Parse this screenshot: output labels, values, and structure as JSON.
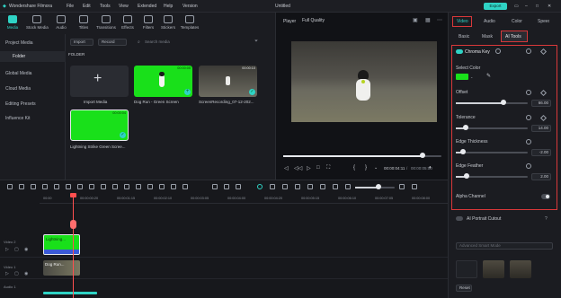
{
  "app": {
    "name": "Wondershare Filmora",
    "doc_title": "Untitled",
    "export_label": "Export"
  },
  "menu": [
    "File",
    "Edit",
    "Tools",
    "View",
    "Extended",
    "Help",
    "Version"
  ],
  "toolbar": [
    "Media",
    "Stock Media",
    "Audio",
    "Titles",
    "Transitions",
    "Effects",
    "Filters",
    "Stickers",
    "Templates"
  ],
  "sidebar": {
    "items": [
      {
        "label": "Project Media"
      },
      {
        "label": "Folder"
      },
      {
        "label": "Global Media"
      },
      {
        "label": "Cloud Media"
      },
      {
        "label": "Editing Presets"
      },
      {
        "label": "Influence Kit"
      }
    ]
  },
  "library": {
    "import_dropdown": "Import",
    "sort_dropdown": "Record",
    "search_placeholder": "Search media",
    "folder_label": "FOLDER",
    "items": [
      {
        "caption": "Import Media"
      },
      {
        "caption": "Dog Run - Green Screen",
        "duration": "00:00:05"
      },
      {
        "caption": "ScreenRecording_07-12-202...",
        "duration": "00:00:10"
      },
      {
        "caption": "Lightning Strike Green Scree...",
        "duration": "00:00:04"
      }
    ]
  },
  "player": {
    "label": "Player",
    "quality": "Full Quality",
    "time_current": "00:00:04:11",
    "time_total": "00:00:05:00",
    "progress": 0.88
  },
  "panel": {
    "tabs": [
      "Video",
      "Audio",
      "Color",
      "Speed"
    ],
    "subtabs": [
      "Basic",
      "Mask",
      "AI Tools"
    ],
    "section_title": "Chroma Key",
    "select_color_label": "Select Color",
    "key_color": "#19e01a",
    "params": [
      {
        "label": "Offset",
        "value": "66.00",
        "fraction": 0.66
      },
      {
        "label": "Tolerance",
        "value": "14.00",
        "fraction": 0.14
      },
      {
        "label": "Edge Thickness",
        "value": "-2.00",
        "fraction": 0.1
      },
      {
        "label": "Edge Feather",
        "value": "2.00",
        "fraction": 0.15
      }
    ],
    "alpha_channel_label": "Alpha Channel",
    "ai_portrait_label": "AI Portrait Cutout",
    "preset_dropdown": "Advanced Smart Mode",
    "reset_label": "Reset"
  },
  "timeline": {
    "ruler": [
      "00:00",
      "00:00:00:20",
      "00:00:01:15",
      "00:00:02:10",
      "00:00:03:05",
      "00:00:04:00",
      "00:00:04:20",
      "00:00:05:15",
      "00:00:06:10",
      "00:00:07:05",
      "00:00:08:00"
    ],
    "tracks": [
      {
        "label": "Video 2",
        "clip": "Lightning..."
      },
      {
        "label": "Video 1",
        "clip": "Dog Run..."
      },
      {
        "label": "Audio 1",
        "clip": ""
      }
    ]
  },
  "colors": {
    "accent": "#2fd3c5",
    "highlight_box": "#d9383a",
    "green_screen": "#19e01a",
    "playhead": "#ff4f4f"
  }
}
